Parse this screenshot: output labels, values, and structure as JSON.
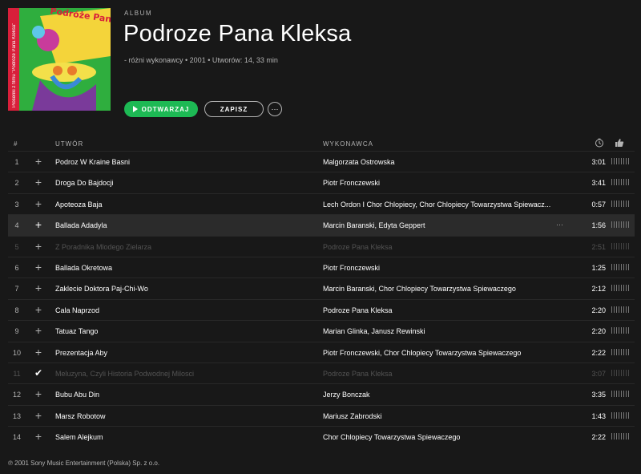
{
  "album": {
    "type_label": "ALBUM",
    "title": "Podroze Pana Kleksa",
    "meta": "- różni wykonawcy • 2001 • Utworów: 14, 33 min",
    "cover": {
      "title_text": "Podróże Pana Kleksa",
      "side_text": "Piosenki z filmu \"Podróże Pana Kleksa\""
    }
  },
  "actions": {
    "play_label": "ODTWARZAJ",
    "save_label": "ZAPISZ",
    "more_label": "···"
  },
  "table": {
    "headers": {
      "num": "#",
      "track": "UTWÓR",
      "artist": "WYKONAWCA",
      "clock_icon": "clock-icon",
      "thumb_icon": "thumbs-up-icon"
    },
    "rows": [
      {
        "num": "1",
        "title": "Podroz W Kraine Basni",
        "artist": "Malgorzata Ostrowska",
        "duration": "3:01",
        "state": "normal"
      },
      {
        "num": "2",
        "title": "Droga Do Bajdocji",
        "artist": "Piotr Fronczewski",
        "duration": "3:41",
        "state": "normal"
      },
      {
        "num": "3",
        "title": "Apoteoza Baja",
        "artist": "Lech Ordon I Chor Chlopiecy, Chor Chlopiecy Towarzystwa Spiewacz...",
        "duration": "0:57",
        "state": "normal"
      },
      {
        "num": "4",
        "title": "Ballada Adadyla",
        "artist": "Marcin Baranski, Edyta Geppert",
        "duration": "1:56",
        "state": "hover",
        "menu": "···"
      },
      {
        "num": "5",
        "title": "Z Poradnika Mlodego Zielarza",
        "artist": "Podroze Pana Kleksa",
        "duration": "2:51",
        "state": "dim"
      },
      {
        "num": "6",
        "title": "Ballada Okretowa",
        "artist": "Piotr Fronczewski",
        "duration": "1:25",
        "state": "normal"
      },
      {
        "num": "7",
        "title": "Zaklecie Doktora Paj-Chi-Wo",
        "artist": "Marcin Baranski, Chor Chlopiecy Towarzystwa Spiewaczego",
        "duration": "2:12",
        "state": "normal"
      },
      {
        "num": "8",
        "title": "Cala Naprzod",
        "artist": "Podroze Pana Kleksa",
        "duration": "2:20",
        "state": "normal"
      },
      {
        "num": "9",
        "title": "Tatuaz Tango",
        "artist": "Marian Glinka, Janusz Rewinski",
        "duration": "2:20",
        "state": "normal"
      },
      {
        "num": "10",
        "title": "Prezentacja Aby",
        "artist": "Piotr Fronczewski, Chor Chlopiecy Towarzystwa Spiewaczego",
        "duration": "2:22",
        "state": "normal"
      },
      {
        "num": "11",
        "title": "Meluzyna, Czyli Historia Podwodnej Milosci",
        "artist": "Podroze Pana Kleksa",
        "duration": "3:07",
        "state": "dim",
        "saved": true
      },
      {
        "num": "12",
        "title": "Bubu Abu Din",
        "artist": "Jerzy Bonczak",
        "duration": "3:35",
        "state": "normal"
      },
      {
        "num": "13",
        "title": "Marsz Robotow",
        "artist": "Mariusz Zabrodski",
        "duration": "1:43",
        "state": "normal"
      },
      {
        "num": "14",
        "title": "Salem Alejkum",
        "artist": "Chor Chlopiecy Towarzystwa Spiewaczego",
        "duration": "2:22",
        "state": "normal"
      }
    ]
  },
  "footer": {
    "copyright": "℗ 2001 Sony Music Entertainment (Polska) Sp. z o.o."
  },
  "colors": {
    "background": "#181818",
    "accent": "#1db954",
    "row_divider": "#282828",
    "hover_row": "#2b2b2b",
    "muted_text": "#b3b3b3",
    "dim_text": "#535353"
  }
}
